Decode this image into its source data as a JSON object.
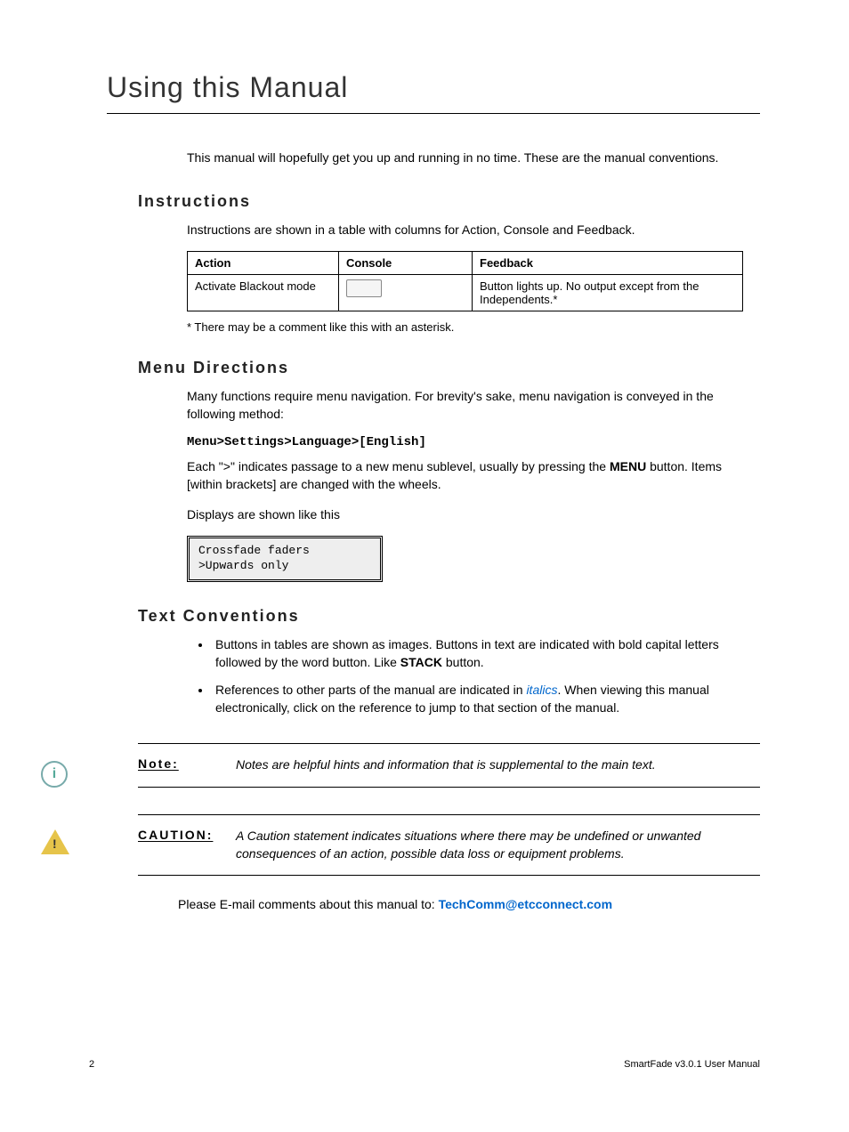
{
  "title": "Using this Manual",
  "intro": "This manual will hopefully get you up and running in no time. These are the manual conventions.",
  "sections": {
    "instructions": {
      "heading": "Instructions",
      "lead": "Instructions are shown in a table with columns for Action, Console and Feedback.",
      "table": {
        "headers": [
          "Action",
          "Console",
          "Feedback"
        ],
        "row": {
          "action": "Activate Blackout mode",
          "feedback": "Button lights up. No output except from the Independents.*"
        }
      },
      "footnote": "* There may be a comment like this with an asterisk."
    },
    "menu": {
      "heading": "Menu Directions",
      "lead": "Many functions require menu navigation. For brevity's sake, menu navigation is conveyed in the following method:",
      "path": "Menu>Settings>Language>[English]",
      "explain_pre": "Each \"",
      "explain_mid": "\" indicates passage to a new menu sublevel, usually by pressing the ",
      "explain_menu": "MENU",
      "explain_post": " button. Items [within brackets] are changed with the wheels.",
      "displays_lead": "Displays are shown like this",
      "display_line1": "Crossfade faders",
      "display_line2": ">Upwards only"
    },
    "text": {
      "heading": "Text Conventions",
      "bullet1_pre": "Buttons in tables are shown as images. Buttons in text are indicated with bold capital letters followed by the word button. Like ",
      "bullet1_bold": "STACK",
      "bullet1_post": " button.",
      "bullet2_pre": "References to other parts of the manual are indicated in ",
      "bullet2_italic": "italics",
      "bullet2_post": ". When viewing this manual electronically, click on the reference to jump to that section of the manual."
    }
  },
  "note": {
    "label": "Note:",
    "text": "Notes are helpful hints and information that is supplemental to the main text."
  },
  "caution": {
    "label": "CAUTION:",
    "text": "A Caution statement indicates situations where there may be undefined or unwanted consequences of an action, possible data loss or equipment problems."
  },
  "email": {
    "lead": "Please E-mail comments about this manual to: ",
    "address": "TechComm@etcconnect.com"
  },
  "footer": {
    "page": "2",
    "doc": "SmartFade v3.0.1 User Manual"
  }
}
